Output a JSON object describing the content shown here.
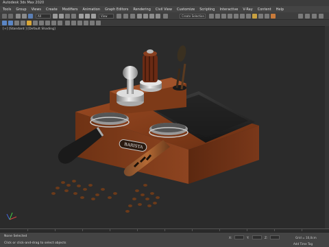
{
  "window": {
    "title": "Autodesk 3ds Max 2020"
  },
  "menu": [
    "Tools",
    "Group",
    "Views",
    "Create",
    "Modifiers",
    "Animation",
    "Graph Editors",
    "Rendering",
    "Civil View",
    "Customize",
    "Scripting",
    "Interactive",
    "V-Ray",
    "Content",
    "Help"
  ],
  "toolbar": {
    "selection_filter": "All",
    "view_dropdown": "View",
    "named_selection": "Create Selection Se"
  },
  "viewport": {
    "label": "[+] [Standard ] [Default Shading]",
    "plate_text": "BARISTA"
  },
  "status": {
    "selection": "None Selected",
    "prompt": "Click or click-and-drag to select objects",
    "x_label": "X:",
    "y_label": "Y:",
    "z_label": "Z:",
    "grid": "Grid = 10,0cm",
    "add_time_tag": "Add Time Tag"
  },
  "colors": {
    "accent": "#4aa3df",
    "wood": "#7a3a1a",
    "viewport_bg": "#2b2b2b"
  }
}
